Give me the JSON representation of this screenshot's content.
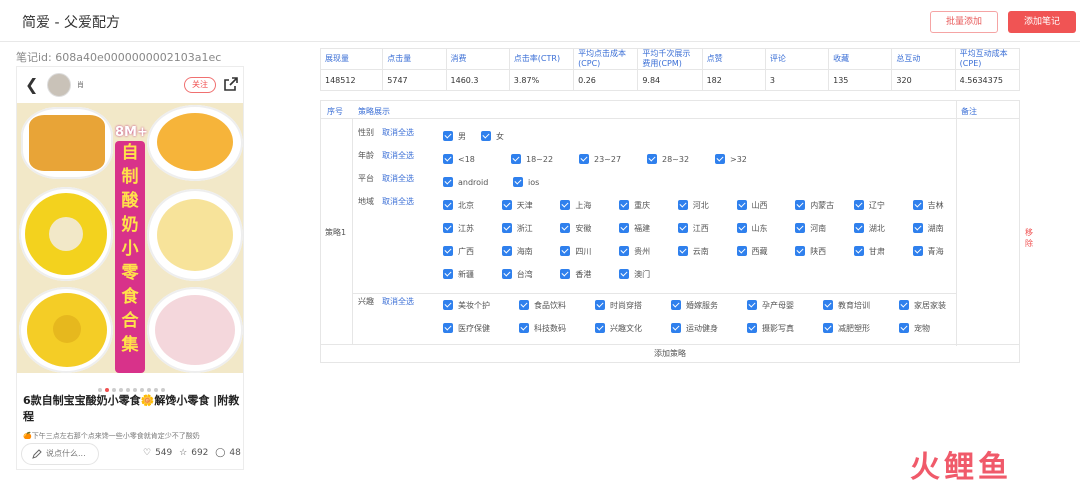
{
  "header": {
    "title": "简爱 - 父爱配方",
    "batch_add": "批量添加",
    "add_note": "添加笔记"
  },
  "note": {
    "id_label": "笔记id:",
    "id_value": "608a40e0000000002103a1ec",
    "user": "肖",
    "follow": "关注",
    "image_banner": [
      "自",
      "制",
      "酸",
      "奶",
      "小",
      "零",
      "食",
      "合",
      "集"
    ],
    "image_badge": "8M+",
    "title": "6款自制宝宝酸奶小零食🌼解馋小零食 |附教程",
    "subtitle": "🍊下午三点左右那个点来馋一些小零食就肯定少不了酸奶",
    "comment_placeholder": "说点什么...",
    "likes": "549",
    "collects": "692",
    "comments": "48"
  },
  "metrics": {
    "headers": [
      "展现量",
      "点击量",
      "消费",
      "点击率(CTR)",
      "平均点击成本(CPC)",
      "平均千次展示费用(CPM)",
      "点赞",
      "评论",
      "收藏",
      "总互动",
      "平均互动成本(CPE)"
    ],
    "values": [
      "148512",
      "5747",
      "1460.3",
      "3.87%",
      "0.26",
      "9.84",
      "182",
      "3",
      "135",
      "320",
      "4.5634375"
    ]
  },
  "strategy": {
    "col_no": "序号",
    "col_show": "策略展示",
    "col_note": "备注",
    "name": "策略1",
    "remove": "移除",
    "cancel_all": "取消全选",
    "add": "添加策略",
    "gender": {
      "label": "性别",
      "options": [
        "男",
        "女"
      ]
    },
    "age": {
      "label": "年龄",
      "options": [
        "<18",
        "18~22",
        "23~27",
        "28~32",
        ">32"
      ]
    },
    "platform": {
      "label": "平台",
      "options": [
        "android",
        "ios"
      ]
    },
    "region": {
      "label": "地域",
      "options": [
        "北京",
        "天津",
        "上海",
        "重庆",
        "河北",
        "山西",
        "内蒙古",
        "辽宁",
        "吉林",
        "江苏",
        "浙江",
        "安徽",
        "福建",
        "江西",
        "山东",
        "河南",
        "湖北",
        "湖南",
        "广西",
        "海南",
        "四川",
        "贵州",
        "云南",
        "西藏",
        "陕西",
        "甘肃",
        "青海",
        "新疆",
        "台湾",
        "香港",
        "澳门"
      ]
    },
    "interest": {
      "label": "兴趣",
      "options": [
        "美妆个护",
        "食品饮料",
        "时尚穿搭",
        "婚嫁服务",
        "孕产母婴",
        "教育培训",
        "家居家装",
        "医疗保健",
        "科技数码",
        "兴趣文化",
        "运动健身",
        "摄影写真",
        "减肥塑形",
        "宠物"
      ]
    }
  },
  "watermark": "火鲤鱼"
}
